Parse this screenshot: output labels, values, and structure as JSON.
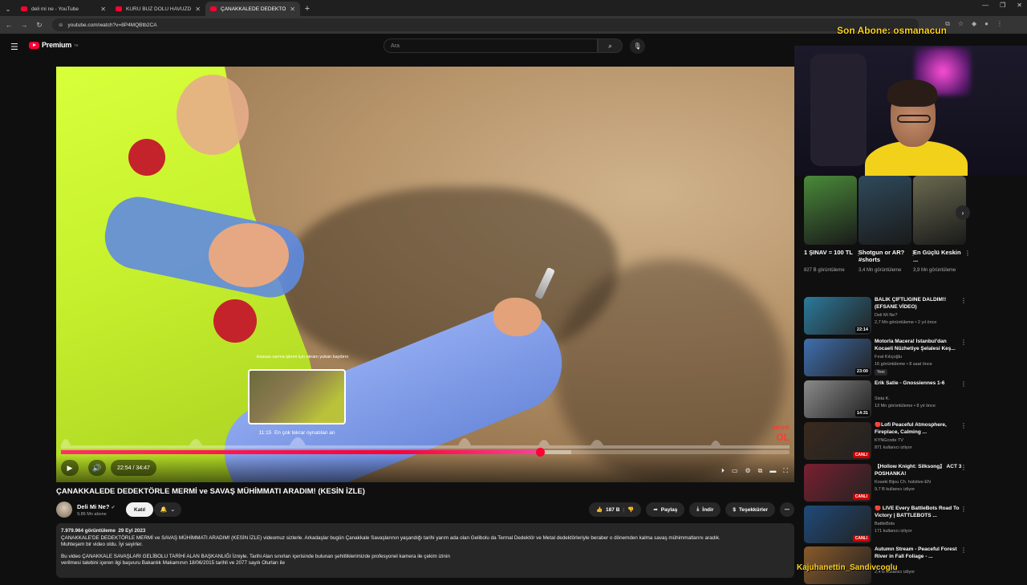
{
  "browser": {
    "tabs": [
      {
        "title": "deli mi ne - YouTube",
        "active": false
      },
      {
        "title": "KURU BUZ DOLU HAVUZDA KA",
        "active": false
      },
      {
        "title": "ÇANAKKALEDE DEDEKTÖRLE M",
        "active": true
      }
    ],
    "url": "youtube.com/watch?v=8P4MQBtb2CA"
  },
  "stream_overlay": {
    "last_sub": "Son Abone: osmanacun",
    "chat_user": "Kajuhanettin_Sandivcoglu"
  },
  "masthead": {
    "logo": "Premium",
    "logo_sup": "TR",
    "search_placeholder": "Ara"
  },
  "player": {
    "hint": "Hassas sarma işlemi için ekranı yukarı kaydırın",
    "preview_time": "11:15",
    "preview_label": "En çok tekrar oynatılan an",
    "current_time": "22:54",
    "duration": "34:47",
    "played_fraction": 0.658,
    "loaded_fraction": 0.7,
    "watermark": "ABONE",
    "watermark_big": "OL"
  },
  "video": {
    "title": "ÇANAKKALEDE DEDEKTÖRLE MERMİ ve SAVAŞ MÜHİMMATI ARADIM! (KESİN İZLE)",
    "channel": "Deli Mi Ne?",
    "subscribers": "9,86 Mn abone",
    "join_label": "Katıl",
    "likes": "187 B",
    "share_label": "Paylaş",
    "download_label": "İndir",
    "thanks_label": "Teşekkürler"
  },
  "description": {
    "views": "7.979.964 görüntüleme",
    "date": "29 Eyl 2023",
    "line1": "ÇANAKKALE'DE DEDEKTÖRLE MERMİ ve SAVAŞ MÜHİMMATI ARADIM! (KESİN İZLE) videomuz sizlerle. Arkadaşlar bugün Çanakkale Savaşlarının yaşandığı tarihi yarım ada olan Gelibolu da Termal Dedektör ve Metal dedektörleriyle beraber o dönemden kalma savaş mühimmatlarını aradık.",
    "line2": "Muhteşem bir video oldu. İyi seyirler.",
    "line3": "Bu video ÇANAKKALE SAVAŞLARI GELİBOLU TARİHİ ALAN BAŞKANLIĞI İzniyle. Tarihi Alan sınırları içerisinde bulunan şehitliklerimizde profesyonel kamera ile çekim izinin",
    "line4": "verilmesi talebini içeren ilgi başvuru Bakanlık Makamının 18/06/2015 tarihli ve 2077 sayılı Olurları ile"
  },
  "shorts": [
    {
      "title": "1 ŞINAV = 100 TL",
      "views": "827 B görüntüleme",
      "color": "#4a8a3a"
    },
    {
      "title": "Shotgun or AR? #shorts",
      "views": "3,4 Mn görüntüleme",
      "color": "#2f4a5c"
    },
    {
      "title": "En Güçlü Keskin ...",
      "views": "3,9 Mn görüntüleme",
      "color": "#6a6a50"
    }
  ],
  "recommended": [
    {
      "title": "BALIK ÇİFTLİĞİNE DALDIM!! (EFSANE VİDEO)",
      "channel": "Deli Mi Ne?",
      "views": "2,7 Mn görüntüleme • 2 yıl önce",
      "duration": "22:14",
      "live": false,
      "badge": "",
      "color": "#2c7a9c"
    },
    {
      "title": "Motorla Macera! İstanbul'dan Kocaeli Nüzhetiye Şelalesi Keş...",
      "channel": "Fırat Kılıçoğlu",
      "views": "16 görüntüleme • 8 saat önce",
      "duration": "23:00",
      "live": false,
      "badge": "Yeni",
      "color": "#3f6fb0"
    },
    {
      "title": "Erik Satie - Gnossiennes 1-6",
      "channel": "Sista K.",
      "views": "13 Mn görüntüleme • 8 yıl önce",
      "duration": "14:31",
      "live": false,
      "badge": "",
      "color": "#8a8a8a"
    },
    {
      "title": "🔴Lofi Peaceful Atmosphere, Fireplace, Calming ...",
      "channel": "KYNGcode TV",
      "views": "871 kullanıcı izliyor",
      "duration": "",
      "live": true,
      "live_label": "CANLI",
      "badge": "",
      "color": "#3a2a1e"
    },
    {
      "title": "【Hollow Knight: Silksong】 ACT 3 POSHANKA!",
      "channel": "Koseki Bijou Ch. hololive-EN",
      "views": "9,7 B kullanıcı izliyor",
      "duration": "",
      "live": true,
      "live_label": "CANLI",
      "badge": "",
      "color": "#7a2030"
    },
    {
      "title": "🔴 LIVE Every BattleBots Road To Victory | BATTLEBOTS ...",
      "channel": "BattleBots",
      "views": "171 kullanıcı izliyor",
      "duration": "",
      "live": true,
      "live_label": "CANLI",
      "badge": "",
      "color": "#1f4a7a"
    },
    {
      "title": "Autumn Stream - Peaceful Forest River in Fall Foliage - ...",
      "channel": "",
      "views": "2,4 B kullanıcı izliyor",
      "duration": "",
      "live": false,
      "badge": "",
      "color": "#8a5a2a"
    }
  ]
}
